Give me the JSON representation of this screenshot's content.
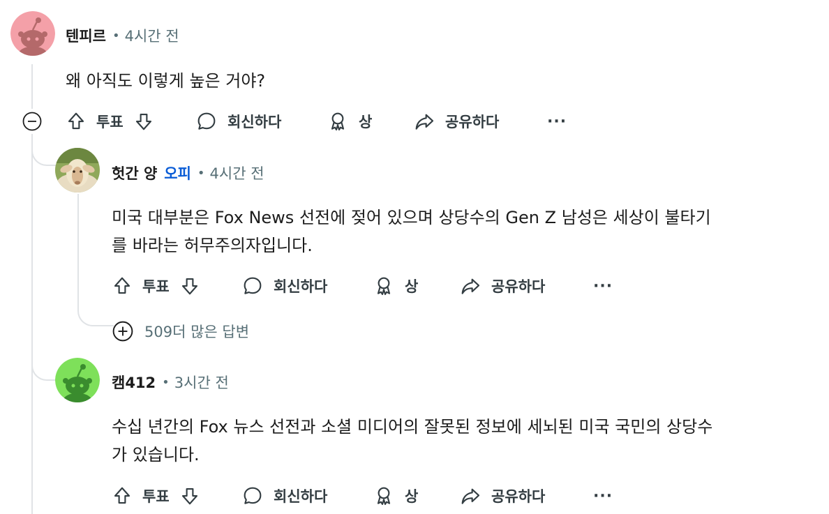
{
  "comments": [
    {
      "author": "텐피르",
      "time": "4시간 전",
      "text_lines": [
        "왜 아직도 이렇게 높은 거야?"
      ],
      "avatar_color": "#f4a0a8"
    },
    {
      "author": "헛간 양",
      "op_label": "오피",
      "time": "4시간 전",
      "text_lines": [
        "미국 대부분은 Fox News 선전에 젖어 있으며 상당수의 Gen Z 남성은 세상이 불타기",
        "를 바라는 허무주의자입니다."
      ],
      "avatar_color": "#caa77a"
    },
    {
      "author": "캠412",
      "time": "3시간 전",
      "text_lines": [
        "수십 년간의 Fox 뉴스 선전과 소셜 미디어의 잘못된 정보에 세뇌된 미국 국민의 상당수",
        "가 있습니다."
      ],
      "avatar_color": "#7ee05a"
    }
  ],
  "actions": {
    "vote": "투표",
    "reply": "회신하다",
    "award": "상",
    "share": "공유하다",
    "more": "···"
  },
  "more_replies": "509더 많은 답변",
  "separator": "•",
  "colors": {
    "op_blue": "#0a5cd6",
    "meta_gray": "#576f76",
    "thread_line": "#e0e3e6"
  }
}
